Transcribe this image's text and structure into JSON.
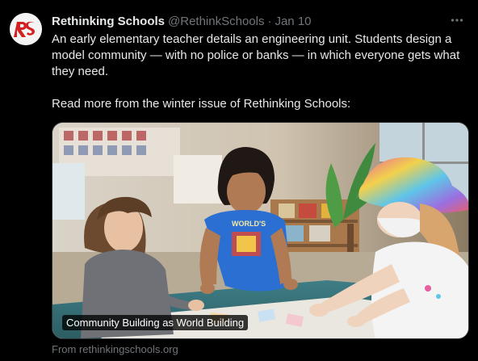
{
  "author": {
    "name": "Rethinking Schools",
    "handle": "@RethinkSchools",
    "separator": "·",
    "date": "Jan 10",
    "avatar_initials": "rs"
  },
  "tweet": {
    "paragraph1": "An early elementary teacher details an engineering unit. Students design a model community — with no police or banks — in which everyone gets what they need.",
    "paragraph2": "Read more from the winter issue of Rethinking Schools:"
  },
  "card": {
    "caption": "Community Building as World Building",
    "source": "From rethinkingschools.org",
    "shirt_text": "WORLD'S"
  },
  "icons": {
    "more": "more-horizontal-icon"
  },
  "colors": {
    "background": "#000000",
    "text": "#e7e9ea",
    "muted": "#71767b",
    "brand_red": "#d42020"
  }
}
